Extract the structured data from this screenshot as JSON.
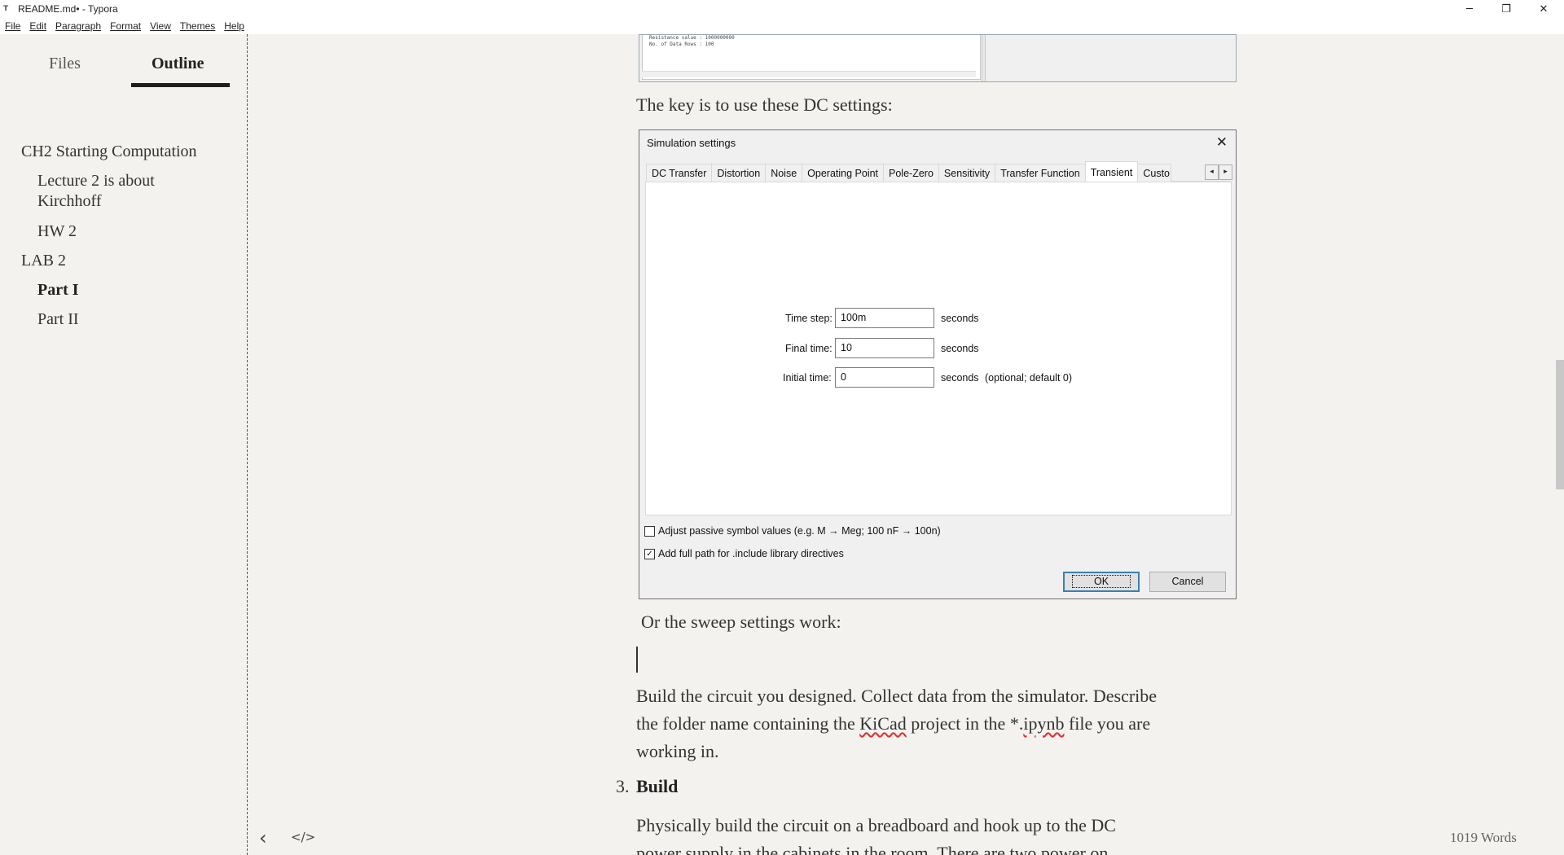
{
  "window": {
    "title": "README.md• - Typora",
    "app_icon": "T",
    "minimize_icon": "─",
    "maximize_icon": "❐",
    "close_icon": "✕"
  },
  "menu": {
    "file": "File",
    "edit": "Edit",
    "paragraph": "Paragraph",
    "format": "Format",
    "view": "View",
    "themes": "Themes",
    "help": "Help"
  },
  "sidebar": {
    "tab_files": "Files",
    "tab_outline": "Outline",
    "outline": [
      {
        "label": "CH2 Starting Computation"
      },
      {
        "label": "Lecture 2 is about"
      },
      {
        "label": "Kirchhoff"
      },
      {
        "label": "HW 2"
      },
      {
        "label": "LAB 2"
      },
      {
        "label": "Part I"
      },
      {
        "label": "Part II"
      }
    ]
  },
  "top_fragment": {
    "line1": "Resistance value : 1000000000",
    "line2": "No. of Data Rows : 100"
  },
  "content": {
    "p_dc": "The key is to use these DC settings:",
    "p_sweep": "Or the sweep settings work:",
    "p_build1": "Build the circuit you designed. Collect data from the simulator. Describe",
    "p_build2_a": "the folder name containing the ",
    "p_build2_kicad": "KiCad",
    "p_build2_b": " project in the *.",
    "p_build2_ipynb": "ipynb",
    "p_build2_c": " file you are",
    "p_build3": "working in.",
    "list_num": "3.",
    "list_heading": "Build",
    "p_phys1": "Physically build the circuit on a breadboard and hook up to the DC",
    "p_phys2": "power supply in the cabinets in the room. There are two power on"
  },
  "dialog": {
    "title": "Simulation settings",
    "close_icon": "✕",
    "tabs": [
      "DC Transfer",
      "Distortion",
      "Noise",
      "Operating Point",
      "Pole-Zero",
      "Sensitivity",
      "Transfer Function",
      "Transient",
      "Custo"
    ],
    "active_tab": "Transient",
    "tab_left_icon": "◂",
    "tab_right_icon": "▸",
    "time_step_label": "Time step:",
    "time_step_value": "100m",
    "final_time_label": "Final time:",
    "final_time_value": "10",
    "initial_time_label": "Initial time:",
    "initial_time_value": "0",
    "seconds": "seconds",
    "optional_note": "(optional; default 0)",
    "chk_adjust_label": "Adjust passive symbol values (e.g. M → Meg; 100 nF → 100n)",
    "chk_adjust_checked": false,
    "chk_fullpath_label": "Add full path for .include library directives",
    "chk_fullpath_checked": true,
    "check_mark": "✓",
    "ok": "OK",
    "cancel": "Cancel"
  },
  "footer": {
    "back_icon": "‹",
    "source_icon": "</>",
    "word_count": "1019 Words"
  }
}
